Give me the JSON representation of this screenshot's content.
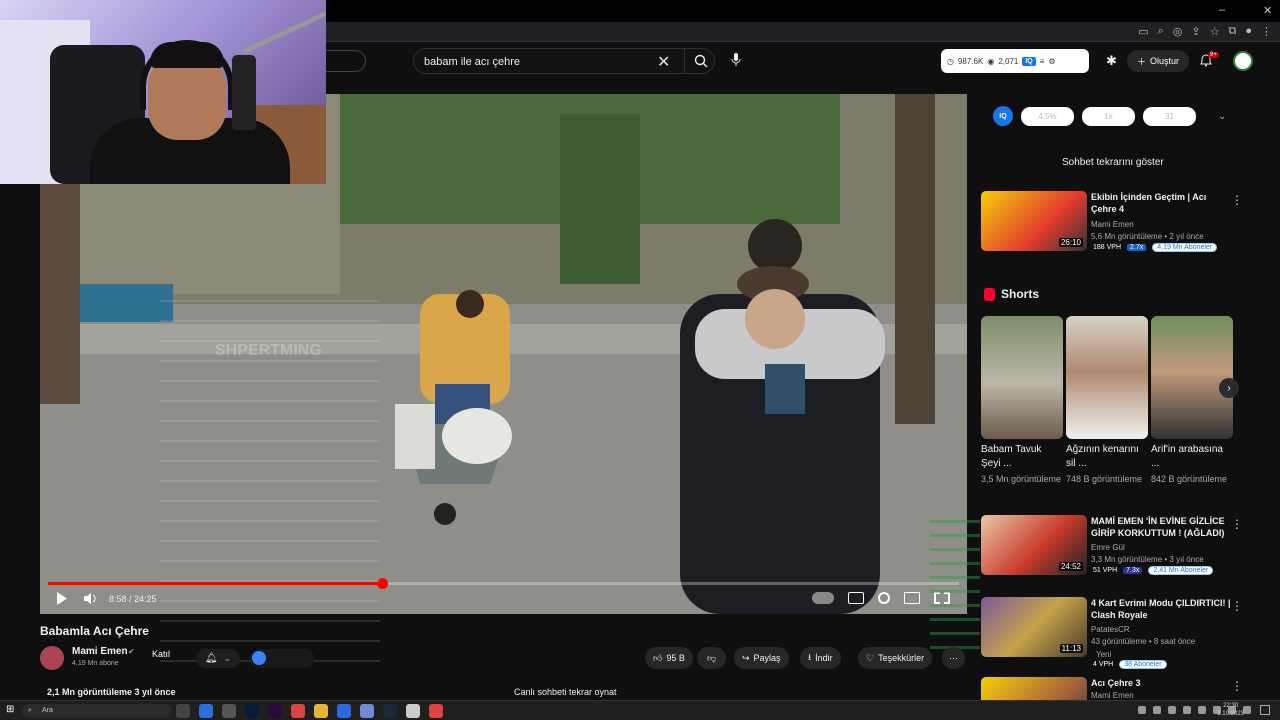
{
  "search": {
    "query": "babam ile acı çehre"
  },
  "header": {
    "stats": {
      "subs_label": "987.6K",
      "views_label": "2,071",
      "iq": "IQ"
    },
    "create_label": "Oluştur",
    "notif_count": "9+"
  },
  "player": {
    "time": "8:58 / 24:25",
    "progress_fraction": 0.367,
    "overlay_text": "SHPERTMING"
  },
  "video": {
    "title": "Babamla Acı Çehre",
    "channel": "Mami Emen",
    "subscribers": "4,19 Mn abone",
    "join_label": "Katıl",
    "likes": "95 B",
    "share_label": "Paylaş",
    "download_label": "İndir",
    "thanks_label": "Teşekkürler",
    "views_line": "2,1 Mn görüntüleme  3 yıl önce",
    "chat_replay_button": "Canlı sohbeti tekrar oynat"
  },
  "toolbar": {
    "iq": "IQ",
    "pill1": "4.5%",
    "pill2": "1x",
    "pill3": "31"
  },
  "sidebar": {
    "chat_replay": "Sohbet tekrarını göster",
    "shorts_label": "Shorts",
    "videos": [
      {
        "title": "Ekibin İçinden Geçtim | Acı Çehre 4",
        "channel": "Mami Emen",
        "meta": "5,6 Mn görüntüleme • 2 yıl önce",
        "duration": "26:10",
        "vph": "188 VPH",
        "mult": "2.7x",
        "subs": "4,19 Mn Aboneler"
      },
      {
        "title": "MAMİ EMEN 'İN EVİNE GİZLİCE GİRİP KORKUTTUM ! (AĞLADI)",
        "channel": "Emre Gül",
        "meta": "3,3 Mn görüntüleme • 3 yıl önce",
        "duration": "24:52",
        "vph": "51 VPH",
        "mult": "7.3x",
        "subs": "2,41 Mn Aboneler"
      },
      {
        "title": "4 Kart Evrimi Modu ÇILDIRTICI! | Clash Royale",
        "channel": "PatatesCR",
        "meta": "43 görüntüleme • 8 saat önce",
        "duration": "11:13",
        "new": "Yeni",
        "vph": "4 VPH",
        "subs": "38 Aboneler"
      },
      {
        "title": "Acı Çehre 3",
        "channel": "Mami Emen"
      }
    ],
    "shorts": [
      {
        "title": "Babam Tavuk Şeyi ...",
        "views": "3,5 Mn görüntüleme"
      },
      {
        "title": "Ağzının kenarını sil ...",
        "views": "748 B görüntüleme"
      },
      {
        "title": "Arif'in arabasına ...",
        "views": "842 B görüntüleme"
      }
    ]
  },
  "taskbar": {
    "search": "Ara",
    "time": "22:30",
    "date": "3.10.2023"
  },
  "colors": {
    "accent": "#ff0000",
    "brand_blue": "#1a73e8"
  }
}
